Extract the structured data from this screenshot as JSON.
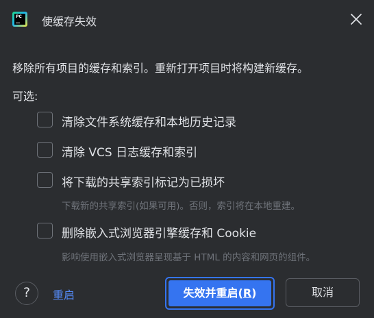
{
  "dialog": {
    "title": "使缓存失效",
    "logo_text": "PC",
    "description": "移除所有项目的缓存和索引。重新打开项目时将构建新缓存。",
    "options_label": "可选:"
  },
  "options": [
    {
      "label": "清除文件系统缓存和本地历史记录",
      "checked": false
    },
    {
      "label": "清除 VCS 日志缓存和索引",
      "checked": false
    },
    {
      "label": "将下载的共享索引标记为已损坏",
      "checked": false,
      "hint": "下载新的共享索引(如果可用)。否则，索引将在本地重建。"
    },
    {
      "label": "删除嵌入式浏览器引擎缓存和 Cookie",
      "checked": false,
      "hint": "影响使用嵌入式浏览器呈现基于 HTML 的内容和网页的组件。"
    }
  ],
  "footer": {
    "help_label": "?",
    "restart_label": "重启",
    "primary_label": "失效并重启(",
    "primary_mnemonic": "R",
    "primary_suffix": ")",
    "cancel_label": "取消"
  },
  "colors": {
    "background": "#2b2d30",
    "text": "#dfe1e5",
    "hint": "#6f737a",
    "accent": "#3574f0",
    "link": "#548af7"
  },
  "icons": {
    "close": "close-icon",
    "help": "help-icon",
    "app": "pycharm-logo-icon"
  }
}
